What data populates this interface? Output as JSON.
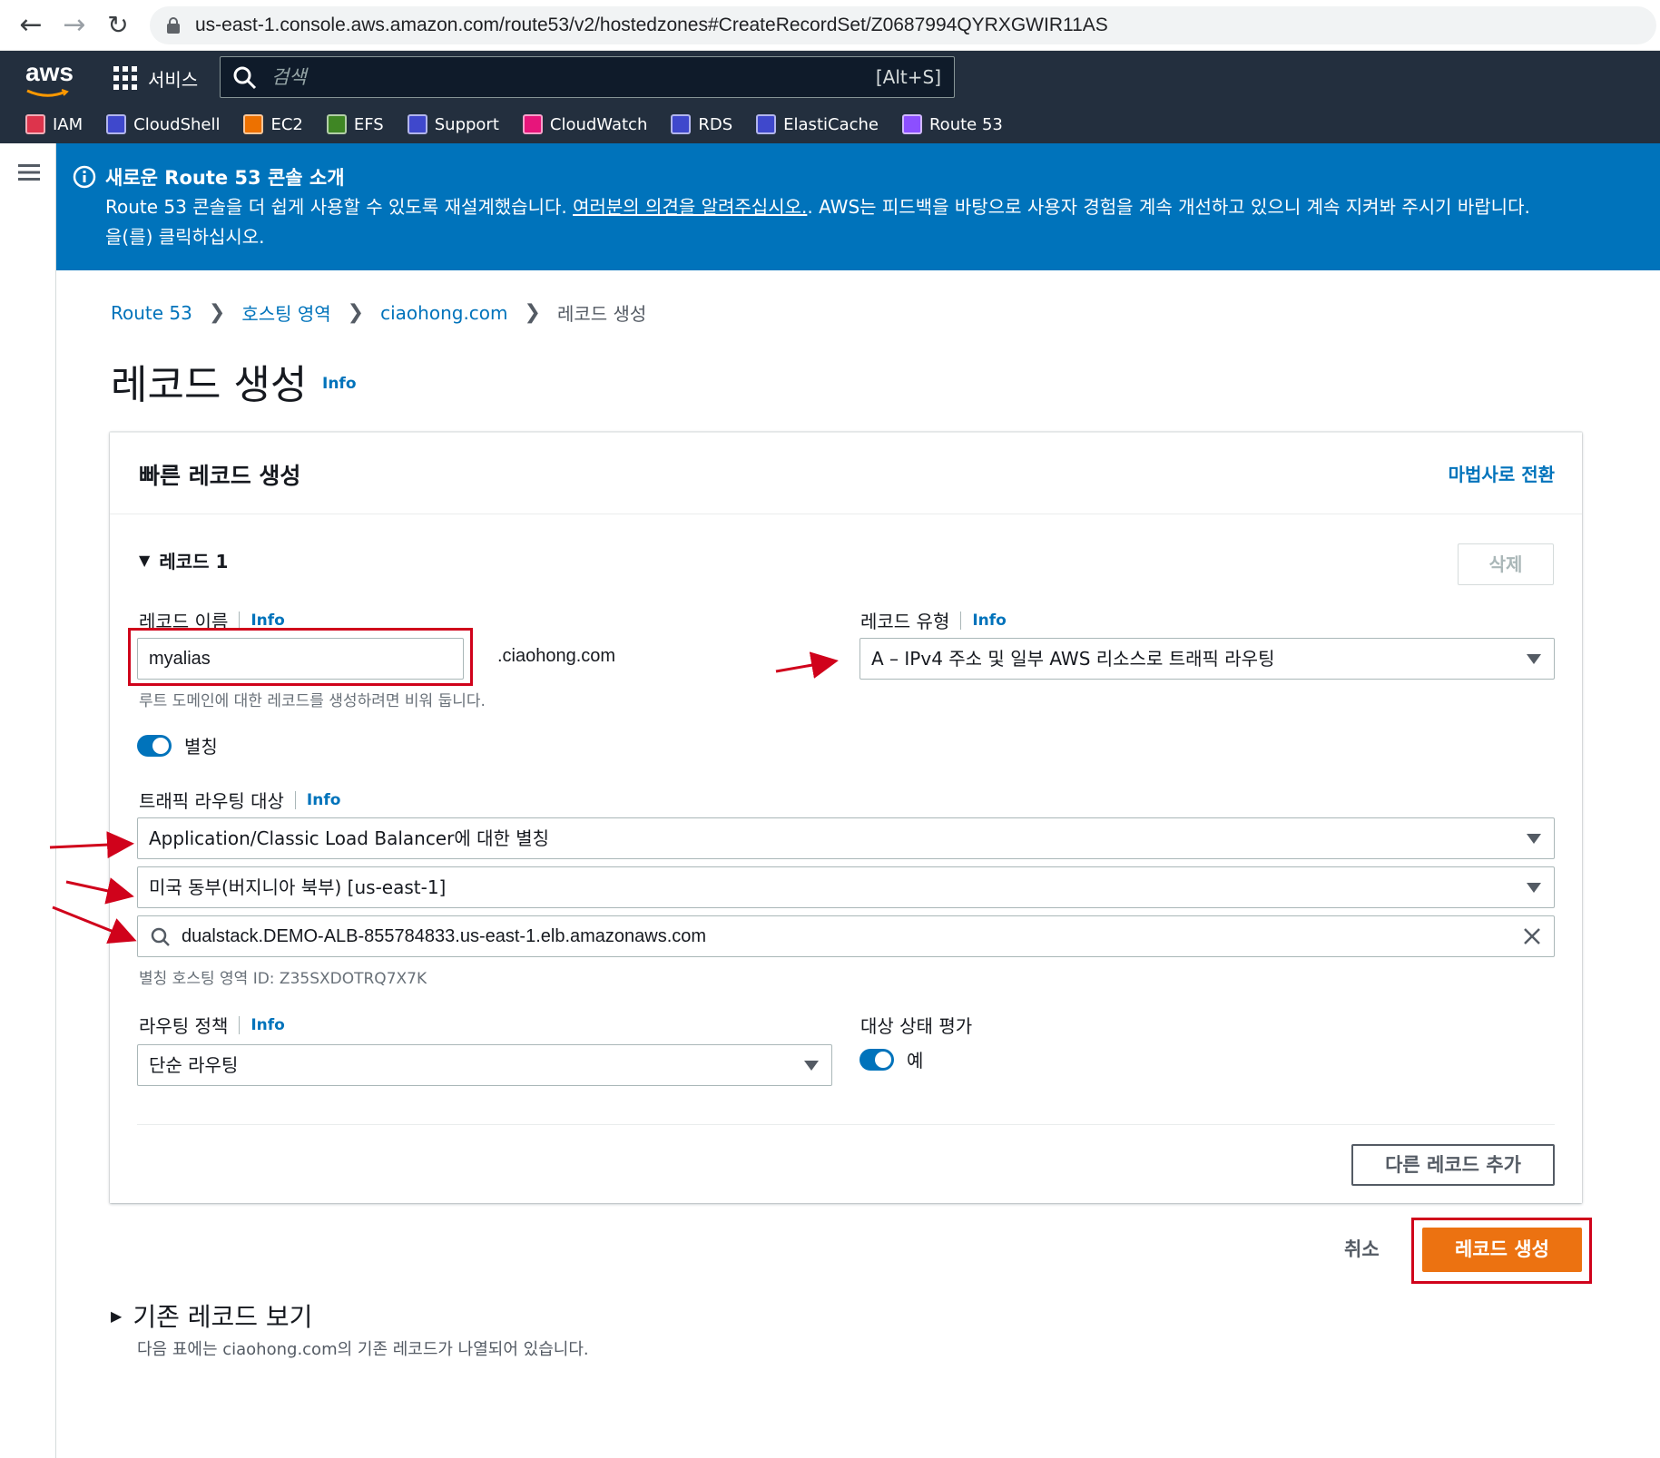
{
  "browser": {
    "url": "us-east-1.console.aws.amazon.com/route53/v2/hostedzones#CreateRecordSet/Z0687994QYRXGWIR11AS"
  },
  "aws_header": {
    "logo": "aws",
    "services_label": "서비스",
    "search_placeholder": "검색",
    "search_shortcut": "[Alt+S]",
    "shortcuts": [
      "IAM",
      "CloudShell",
      "EC2",
      "EFS",
      "Support",
      "CloudWatch",
      "RDS",
      "ElastiCache",
      "Route 53"
    ],
    "shortcut_colors": [
      "#dd344c",
      "#3f48cc",
      "#ed7100",
      "#3f8624",
      "#3f48cc",
      "#e7157b",
      "#3f48cc",
      "#3f48cc",
      "#8c4fff"
    ]
  },
  "banner": {
    "title": "새로운 Route 53 콘솔 소개",
    "body_before": "Route 53 콘솔을 더 쉽게 사용할 수 있도록 재설계했습니다. ",
    "link": "여러분의 의견을 알려주십시오.",
    "body_after": ". AWS는 피드백을 바탕으로 사용자 경험을 계속 개선하고 있으니 계속 지켜봐 주시기 바랍니다.",
    "body_line2": "을(를) 클릭하십시오."
  },
  "breadcrumb": {
    "items": [
      "Route 53",
      "호스팅 영역",
      "ciaohong.com"
    ],
    "current": "레코드 생성"
  },
  "page": {
    "title": "레코드 생성",
    "info": "Info"
  },
  "card": {
    "title": "빠른 레코드 생성",
    "wizard_link": "마법사로 전환",
    "record_header": "레코드 1",
    "delete_label": "삭제",
    "record_name_label": "레코드 이름",
    "record_name_value": "myalias",
    "domain_suffix": ".ciaohong.com",
    "record_name_hint": "루트 도메인에 대한 레코드를 생성하려면 비워 둡니다.",
    "record_type_label": "레코드 유형",
    "record_type_value": "A – IPv4 주소 및 일부 AWS 리소스로 트래픽 라우팅",
    "alias_label": "별칭",
    "target_label": "트래픽 라우팅 대상",
    "target_value": "Application/Classic Load Balancer에 대한 별칭",
    "region_value": "미국 동부(버지니아 북부) [us-east-1]",
    "lb_value": "dualstack.DEMO-ALB-855784833.us-east-1.elb.amazonaws.com",
    "zone_hint": "별칭 호스팅 영역 ID: Z35SXDOTRQ7X7K",
    "routing_policy_label": "라우팅 정책",
    "routing_policy_value": "단순 라우팅",
    "health_label": "대상 상태 평가",
    "health_value": "예",
    "info": "Info",
    "add_record_label": "다른 레코드 추가"
  },
  "actions": {
    "cancel": "취소",
    "create": "레코드 생성"
  },
  "existing": {
    "title": "기존 레코드 보기",
    "desc": "다음 표에는 ciaohong.com의 기존 레코드가 나열되어 있습니다."
  },
  "colors": {
    "aws_header": "#232f3e",
    "banner": "#0073bb",
    "link": "#0073bb",
    "primary_button": "#ec7211",
    "annotation_red": "#d0021b"
  }
}
